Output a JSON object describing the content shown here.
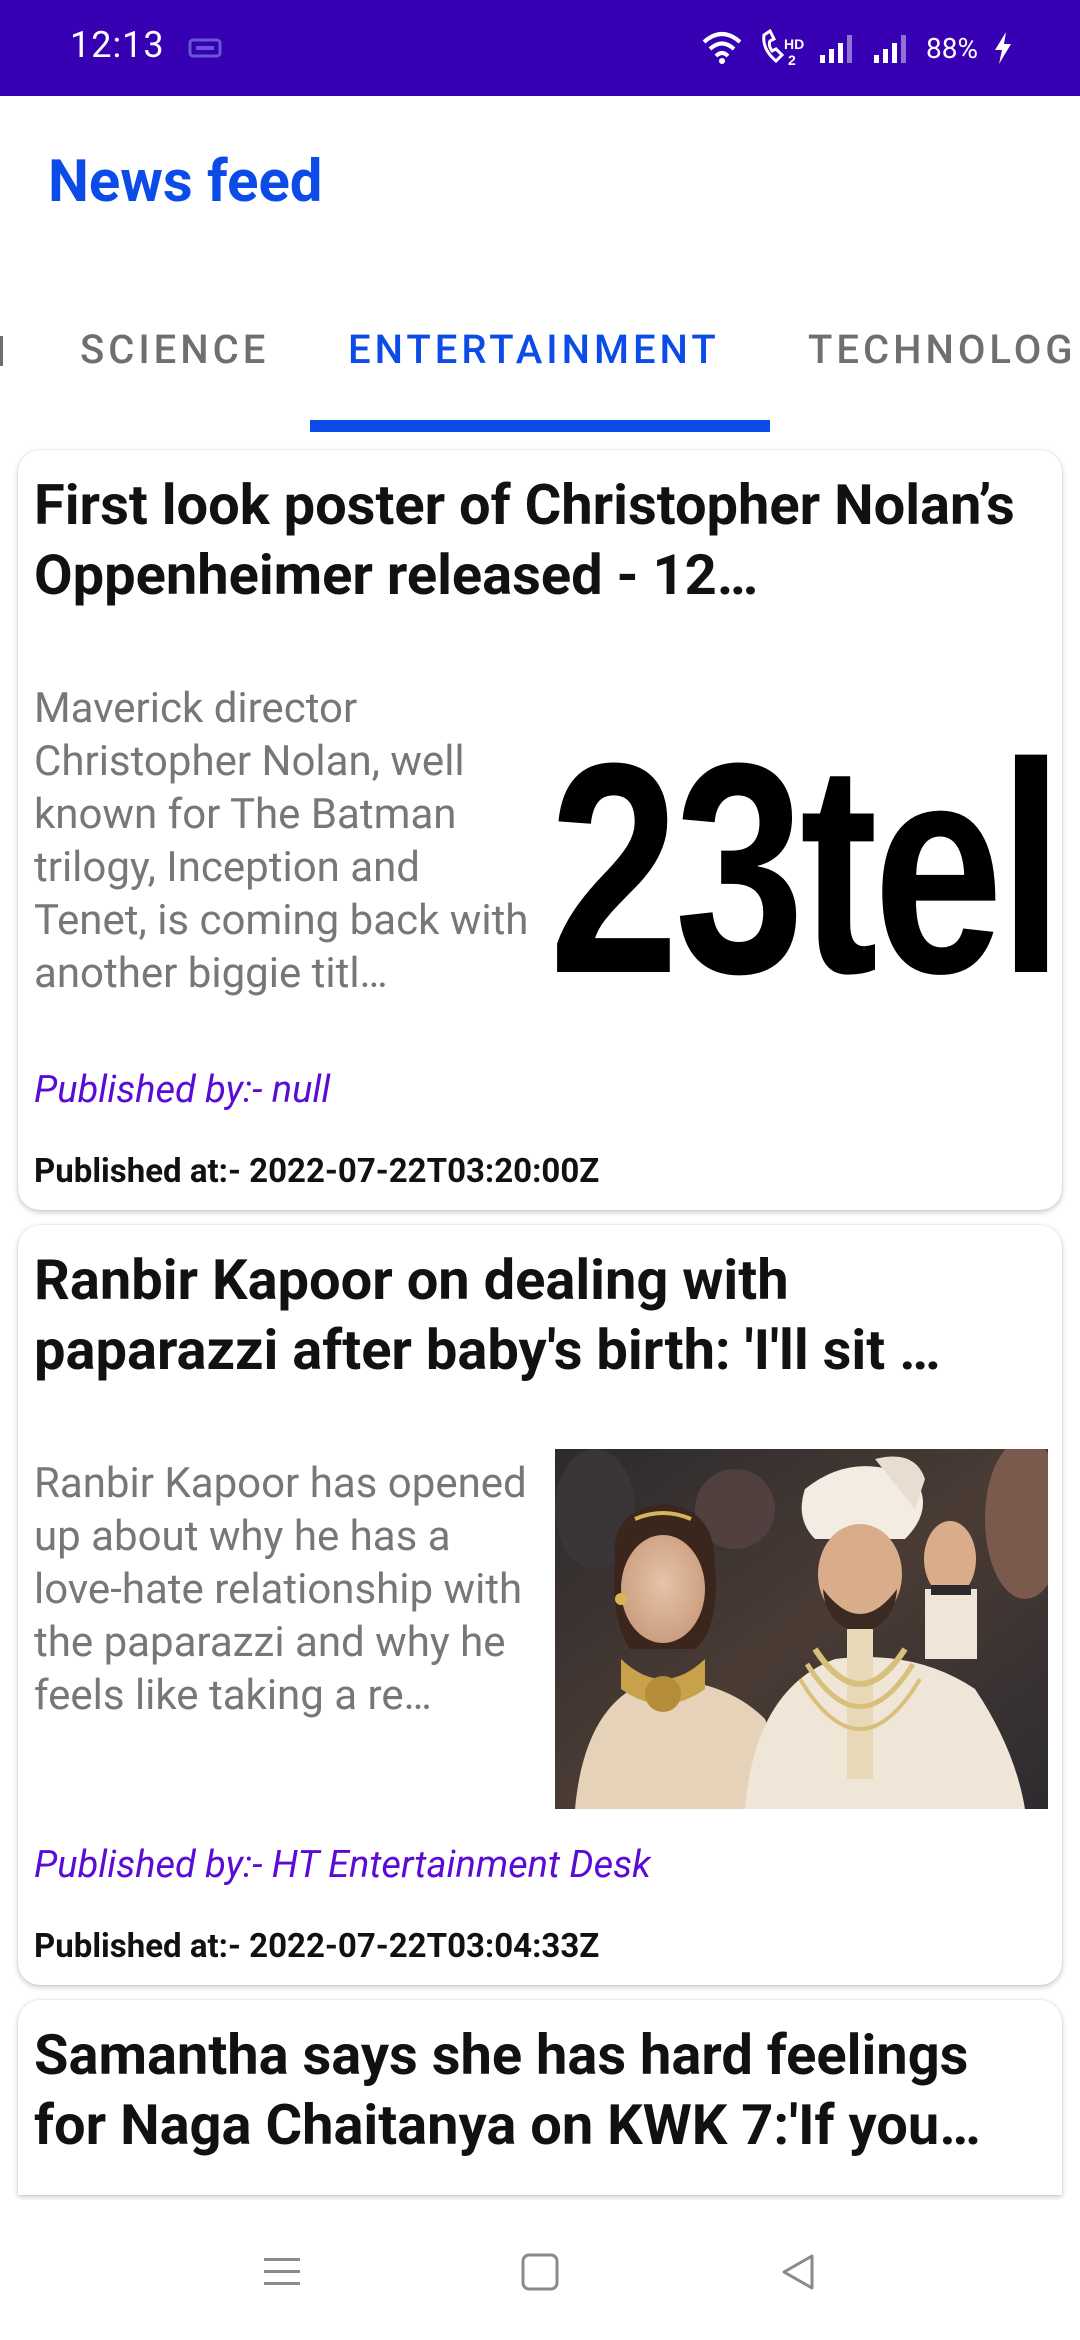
{
  "status_bar": {
    "time": "12:13",
    "battery": "88%"
  },
  "app": {
    "title": "News feed"
  },
  "tabs": [
    {
      "label": "SCIENCE",
      "active": false
    },
    {
      "label": "ENTERTAINMENT",
      "active": true
    },
    {
      "label": "TECHNOLOG",
      "active": false
    }
  ],
  "articles": [
    {
      "title": "First look poster of Christopher Nolan’s Oppenheimer released - 12…",
      "description": "Maverick director Christopher Nolan, well known for The Batman trilogy, Inception and Tenet, is coming back with another biggie titl…",
      "image_text": "23tel",
      "published_by": "Published by:- null",
      "published_at": "Published at:- 2022-07-22T03:20:00Z"
    },
    {
      "title": "Ranbir Kapoor on dealing with paparazzi after baby's birth: 'I'll sit …",
      "description": "Ranbir Kapoor has opened up about why he has a love-hate relationship with the paparazzi and why he feels like taking a re…",
      "published_by": "Published by:- HT Entertainment Desk",
      "published_at": "Published at:- 2022-07-22T03:04:33Z"
    },
    {
      "title": "Samantha says she has hard feelings for Naga Chaitanya on KWK 7:'If you…"
    }
  ],
  "colors": {
    "status_bar": "#3700b3",
    "accent": "#0b4ce8",
    "author": "#5b0bd6"
  }
}
